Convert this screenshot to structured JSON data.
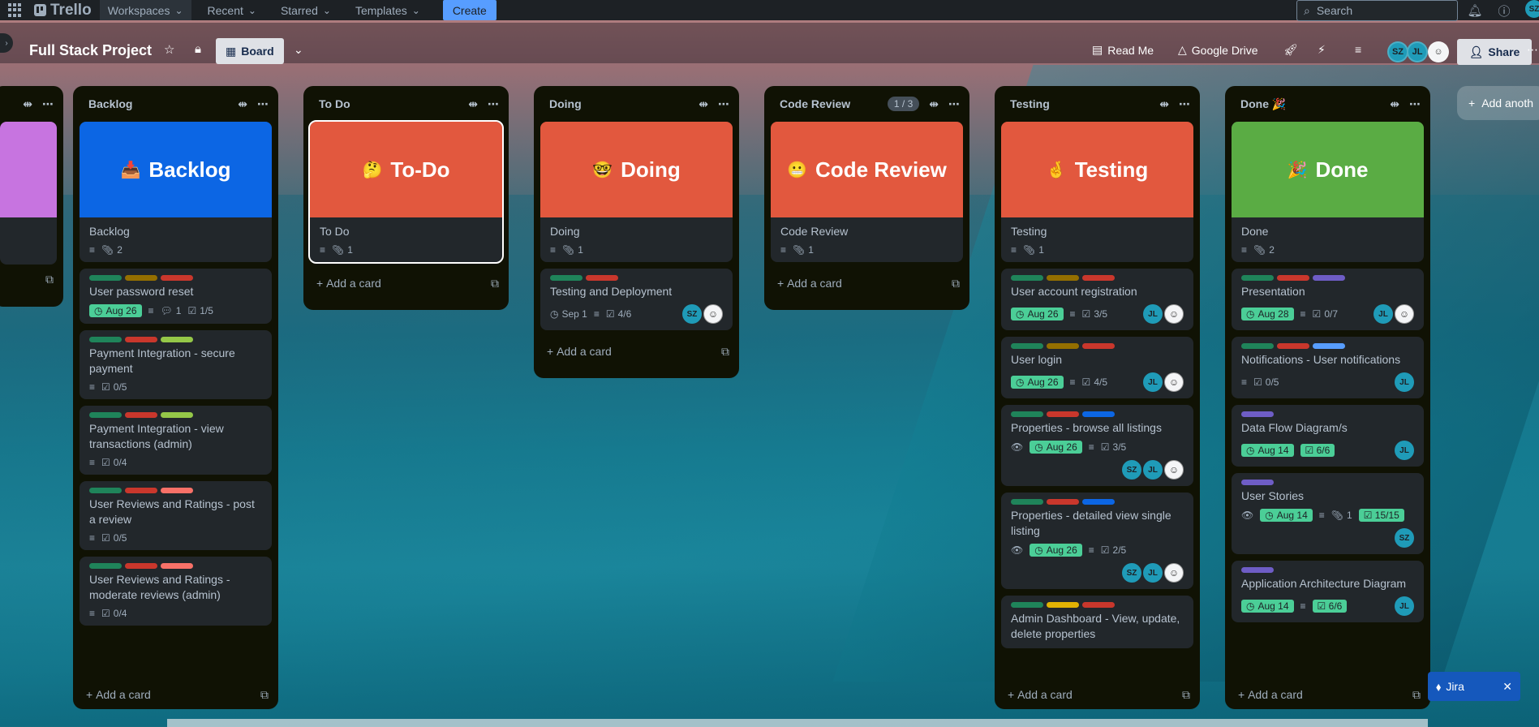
{
  "topbar": {
    "logo": "Trello",
    "nav": [
      {
        "label": "Workspaces"
      },
      {
        "label": "Recent"
      },
      {
        "label": "Starred"
      },
      {
        "label": "Templates"
      }
    ],
    "create_label": "Create",
    "search_placeholder": "Search",
    "avatar_initials": "SZ"
  },
  "board": {
    "title": "Full Stack Project",
    "view_label": "Board",
    "powerups": [
      {
        "label": "Read Me",
        "icon": "readme-icon"
      },
      {
        "label": "Google Drive",
        "icon": "google-drive-icon"
      }
    ],
    "member_initials": [
      "SZ",
      "JL"
    ],
    "share_label": "Share",
    "add_list_label": "Add anoth"
  },
  "lists": [
    {
      "name": "Backlog",
      "cover_title": "Backlog",
      "cover_emoji": "📥",
      "cover_color": "#0c66e4",
      "cover_card_title": "Backlog",
      "cover_card_attachments": "2",
      "cards": [
        {
          "title": "User password reset",
          "labels": [
            "#1f845a",
            "#946f00",
            "#c9372c"
          ],
          "date": "Aug 26",
          "comments": "1",
          "checklist": "1/5"
        },
        {
          "title": "Payment Integration - secure payment",
          "labels": [
            "#1f845a",
            "#c9372c",
            "#94c748"
          ],
          "checklist": "0/5"
        },
        {
          "title": "Payment Integration - view transactions (admin)",
          "labels": [
            "#1f845a",
            "#c9372c",
            "#94c748"
          ],
          "checklist": "0/4"
        },
        {
          "title": "User Reviews and Ratings - post a review",
          "labels": [
            "#1f845a",
            "#c9372c",
            "#f87168"
          ],
          "checklist": "0/5"
        },
        {
          "title": "User Reviews and Ratings - moderate reviews (admin)",
          "labels": [
            "#1f845a",
            "#c9372c",
            "#f87168"
          ],
          "checklist": "0/4"
        }
      ],
      "add_card": "Add a card"
    },
    {
      "name": "To Do",
      "cover_title": "To-Do",
      "cover_emoji": "🤔",
      "cover_color": "#e2583e",
      "cover_card_title": "To Do",
      "cover_card_attachments": "1",
      "cards": [],
      "add_card": "Add a card"
    },
    {
      "name": "Doing",
      "cover_title": "Doing",
      "cover_emoji": "🤓",
      "cover_color": "#e2583e",
      "cover_card_title": "Doing",
      "cover_card_attachments": "1",
      "cards": [
        {
          "title": "Testing and Deployment",
          "labels": [
            "#1f845a",
            "#c9372c"
          ],
          "date_plain": "Sep 1",
          "checklist": "4/6",
          "members": [
            "SZ",
            "face"
          ]
        }
      ],
      "add_card": "Add a card"
    },
    {
      "name": "Code Review",
      "counter": "1 / 3",
      "cover_title": "Code Review",
      "cover_emoji": "😬",
      "cover_color": "#e2583e",
      "cover_card_title": "Code Review",
      "cover_card_attachments": "1",
      "cards": [],
      "add_card": "Add a card"
    },
    {
      "name": "Testing",
      "cover_title": "Testing",
      "cover_emoji": "🤞",
      "cover_color": "#e2583e",
      "cover_card_title": "Testing",
      "cover_card_attachments": "1",
      "cards": [
        {
          "title": "User account registration",
          "labels": [
            "#1f845a",
            "#946f00",
            "#c9372c"
          ],
          "date": "Aug 26",
          "checklist": "3/5",
          "members": [
            "JL",
            "face"
          ]
        },
        {
          "title": "User login",
          "labels": [
            "#1f845a",
            "#946f00",
            "#c9372c"
          ],
          "date": "Aug 26",
          "checklist": "4/5",
          "members": [
            "JL",
            "face"
          ]
        },
        {
          "title": "Properties - browse all listings",
          "labels": [
            "#1f845a",
            "#c9372c",
            "#0c66e4"
          ],
          "watch": true,
          "date": "Aug 26",
          "checklist": "3/5",
          "members": [
            "SZ",
            "JL",
            "face"
          ]
        },
        {
          "title": "Properties - detailed view single listing",
          "labels": [
            "#1f845a",
            "#c9372c",
            "#0c66e4"
          ],
          "watch": true,
          "date": "Aug 26",
          "checklist": "2/5",
          "members": [
            "SZ",
            "JL",
            "face"
          ]
        },
        {
          "title": "Admin Dashboard - View, update, delete properties",
          "labels": [
            "#1f845a",
            "#e2b203",
            "#c9372c"
          ]
        }
      ],
      "add_card": "Add a card"
    },
    {
      "name": "Done",
      "name_emoji": "🎉",
      "cover_title": "Done",
      "cover_emoji": "🎉",
      "cover_color": "#5aac44",
      "cover_card_title": "Done",
      "cover_card_attachments": "2",
      "cards": [
        {
          "title": "Presentation",
          "labels": [
            "#1f845a",
            "#c9372c",
            "#6e5dc6"
          ],
          "date": "Aug 28",
          "checklist": "0/7",
          "members": [
            "JL",
            "face"
          ]
        },
        {
          "title": "Notifications - User notifications",
          "labels": [
            "#1f845a",
            "#c9372c",
            "#579dff"
          ],
          "checklist": "0/5",
          "members": [
            "JL"
          ]
        },
        {
          "title": "Data Flow Diagram/s",
          "labels": [
            "#6e5dc6"
          ],
          "date": "Aug 14",
          "checklist_done": "6/6",
          "members": [
            "JL"
          ]
        },
        {
          "title": "User Stories",
          "labels": [
            "#6e5dc6"
          ],
          "watch": true,
          "date": "Aug 14",
          "attachments": "1",
          "checklist_done": "15/15",
          "members": [
            "SZ"
          ]
        },
        {
          "title": "Application Architecture Diagram",
          "labels": [
            "#6e5dc6"
          ],
          "date": "Aug 14",
          "checklist_done": "6/6",
          "members": [
            "JL"
          ]
        }
      ],
      "add_card": "Add a card"
    }
  ],
  "jira": {
    "label": "Jira"
  }
}
